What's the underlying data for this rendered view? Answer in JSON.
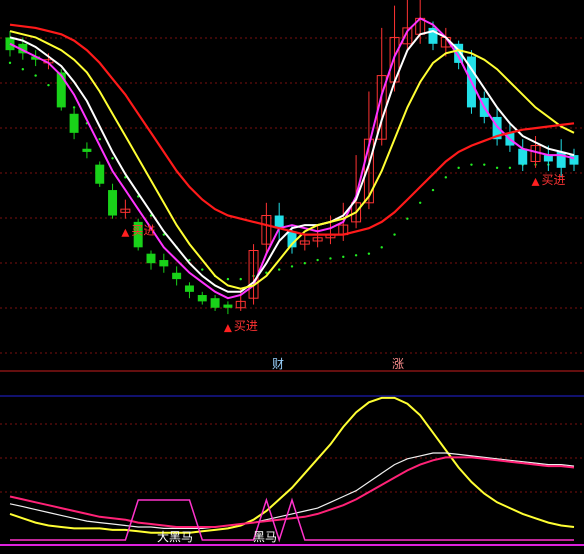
{
  "colors": {
    "background": "#000000",
    "up_candle": "#ff3333",
    "down_candle_light": "#22e0e8",
    "down_candle_dark": "#19d219",
    "ma_magenta": "#ff33ff",
    "ma_white": "#ffffff",
    "ma_yellow": "#ffff33",
    "ma_red": "#ff1a1a",
    "support_dots": "#22ee22",
    "grid": "#7a1010",
    "divider_red": "#c81e1e",
    "divider_blue": "#2222dd",
    "bottom_line": "#dd22dd",
    "osc_yellow": "#ffff33",
    "osc_white": "#f0f0f0",
    "osc_pink": "#ff2277",
    "osc_magenta": "#ff33cc"
  },
  "labels": {
    "buy1": "买进",
    "buy2": "买进",
    "buy3": "买进",
    "cai": "财",
    "zhang": "涨",
    "big_horse": "大黑马",
    "horse": "黑马"
  },
  "chart_data": [
    {
      "type": "candlestick",
      "title": "",
      "y_range": [
        0,
        100
      ],
      "grid": true,
      "candles": [
        {
          "o": 92,
          "c": 88,
          "h": 94,
          "l": 86
        },
        {
          "o": 90,
          "c": 87,
          "h": 92,
          "l": 85
        },
        {
          "o": 86,
          "c": 85,
          "h": 88,
          "l": 83
        },
        {
          "o": 84,
          "c": 85,
          "h": 87,
          "l": 82
        },
        {
          "o": 81,
          "c": 70,
          "h": 82,
          "l": 69
        },
        {
          "o": 68,
          "c": 62,
          "h": 70,
          "l": 60
        },
        {
          "o": 57,
          "c": 56,
          "h": 59,
          "l": 54
        },
        {
          "o": 52,
          "c": 46,
          "h": 53,
          "l": 45
        },
        {
          "o": 44,
          "c": 36,
          "h": 46,
          "l": 35
        },
        {
          "o": 37,
          "c": 38,
          "h": 41,
          "l": 35
        },
        {
          "o": 34,
          "c": 26,
          "h": 35,
          "l": 25
        },
        {
          "o": 24,
          "c": 21,
          "h": 25,
          "l": 19
        },
        {
          "o": 22,
          "c": 20,
          "h": 24,
          "l": 18
        },
        {
          "o": 18,
          "c": 16,
          "h": 20,
          "l": 14
        },
        {
          "o": 14,
          "c": 12,
          "h": 15,
          "l": 10
        },
        {
          "o": 11,
          "c": 9,
          "h": 12,
          "l": 8
        },
        {
          "o": 10,
          "c": 7,
          "h": 11,
          "l": 6
        },
        {
          "o": 8,
          "c": 7,
          "h": 9,
          "l": 5
        },
        {
          "o": 7,
          "c": 9,
          "h": 13,
          "l": 6
        },
        {
          "o": 10,
          "c": 25,
          "h": 27,
          "l": 8
        },
        {
          "o": 27,
          "c": 36,
          "h": 40,
          "l": 24
        },
        {
          "o": 36,
          "c": 32,
          "h": 40,
          "l": 28
        },
        {
          "o": 31,
          "c": 26,
          "h": 33,
          "l": 24
        },
        {
          "o": 27,
          "c": 28,
          "h": 30,
          "l": 25
        },
        {
          "o": 28,
          "c": 29,
          "h": 33,
          "l": 26
        },
        {
          "o": 29,
          "c": 30,
          "h": 36,
          "l": 27
        },
        {
          "o": 30,
          "c": 33,
          "h": 40,
          "l": 28
        },
        {
          "o": 34,
          "c": 40,
          "h": 55,
          "l": 32
        },
        {
          "o": 40,
          "c": 60,
          "h": 75,
          "l": 38
        },
        {
          "o": 60,
          "c": 80,
          "h": 95,
          "l": 58
        },
        {
          "o": 78,
          "c": 92,
          "h": 102,
          "l": 75
        },
        {
          "o": 90,
          "c": 95,
          "h": 105,
          "l": 88
        },
        {
          "o": 93,
          "c": 98,
          "h": 104,
          "l": 90
        },
        {
          "o": 95,
          "c": 90,
          "h": 97,
          "l": 88
        },
        {
          "o": 89,
          "c": 92,
          "h": 95,
          "l": 86
        },
        {
          "o": 90,
          "c": 84,
          "h": 91,
          "l": 82
        },
        {
          "o": 86,
          "c": 70,
          "h": 88,
          "l": 68
        },
        {
          "o": 73,
          "c": 67,
          "h": 75,
          "l": 65
        },
        {
          "o": 67,
          "c": 60,
          "h": 70,
          "l": 58
        },
        {
          "o": 62,
          "c": 58,
          "h": 65,
          "l": 56
        },
        {
          "o": 57,
          "c": 52,
          "h": 60,
          "l": 50
        },
        {
          "o": 53,
          "c": 58,
          "h": 61,
          "l": 51
        },
        {
          "o": 55,
          "c": 53,
          "h": 58,
          "l": 50
        },
        {
          "o": 56,
          "c": 51,
          "h": 60,
          "l": 48
        },
        {
          "o": 55,
          "c": 52,
          "h": 57,
          "l": 50
        }
      ],
      "series": [
        {
          "color": "ma_magenta",
          "values": [
            90,
            88,
            86,
            84,
            80,
            74,
            66,
            58,
            50,
            44,
            38,
            32,
            26,
            22,
            18,
            15,
            12,
            10,
            11,
            14,
            24,
            32,
            33,
            32,
            31,
            32,
            34,
            42,
            58,
            74,
            86,
            94,
            98,
            96,
            92,
            86,
            78,
            70,
            64,
            60,
            57,
            56,
            55,
            55,
            54
          ]
        },
        {
          "color": "ma_white",
          "values": [
            92,
            91,
            89,
            86,
            83,
            78,
            72,
            64,
            56,
            49,
            43,
            37,
            31,
            26,
            21,
            17,
            14,
            12,
            12,
            15,
            21,
            28,
            32,
            33,
            33,
            34,
            36,
            41,
            52,
            66,
            78,
            88,
            93,
            94,
            92,
            88,
            82,
            76,
            70,
            65,
            61,
            59,
            57,
            56,
            55
          ]
        },
        {
          "color": "ma_yellow",
          "values": [
            94,
            93,
            92,
            90,
            88,
            85,
            81,
            75,
            68,
            61,
            54,
            47,
            40,
            33,
            27,
            22,
            17,
            14,
            13,
            14,
            17,
            22,
            27,
            31,
            33,
            34,
            35,
            37,
            42,
            50,
            60,
            70,
            78,
            84,
            87,
            88,
            87,
            85,
            82,
            78,
            74,
            70,
            67,
            64,
            62
          ]
        },
        {
          "color": "ma_red",
          "values": [
            96,
            95.5,
            95,
            94,
            93,
            91,
            88,
            84,
            79,
            74,
            68,
            62,
            56,
            50,
            45,
            41,
            38,
            36,
            35,
            34,
            33,
            32,
            31,
            30,
            30,
            30,
            30,
            31,
            32,
            34,
            37,
            41,
            45,
            49,
            53,
            56,
            58,
            59.5,
            61,
            62,
            63,
            63.5,
            64,
            64.5,
            65
          ]
        },
        {
          "color": "support_dots",
          "values": [
            84,
            82,
            80,
            77,
            74,
            70,
            65,
            60,
            54,
            48,
            42,
            36,
            30,
            26,
            22,
            19,
            17,
            16,
            16,
            17,
            18,
            19,
            20,
            21,
            22,
            22.5,
            23,
            23.5,
            24,
            26,
            30,
            35,
            40,
            44,
            48,
            51,
            52,
            52,
            51,
            51,
            52,
            52,
            52,
            53,
            53
          ]
        }
      ],
      "markers": [
        {
          "index": 9,
          "kind": "buy",
          "label_key": "buy1"
        },
        {
          "index": 17,
          "kind": "buy",
          "label_key": "buy2"
        },
        {
          "index": 41,
          "kind": "buy",
          "label_key": "buy3"
        }
      ]
    },
    {
      "type": "line",
      "title": "",
      "y_range": [
        0,
        100
      ],
      "series": [
        {
          "color": "osc_yellow",
          "values": [
            18,
            15,
            12,
            10,
            9,
            8,
            8,
            8,
            7,
            7,
            6,
            5,
            5,
            5,
            5,
            6,
            7,
            8,
            10,
            14,
            20,
            28,
            36,
            46,
            56,
            66,
            78,
            88,
            95,
            98,
            98,
            94,
            86,
            74,
            62,
            50,
            40,
            32,
            26,
            22,
            18,
            15,
            12,
            10,
            9
          ]
        },
        {
          "color": "osc_white",
          "values": [
            25,
            23,
            21,
            19,
            17,
            15,
            13,
            12,
            11,
            10,
            9,
            9,
            8,
            8,
            8,
            8,
            9,
            10,
            11,
            12,
            14,
            16,
            18,
            20,
            22,
            26,
            30,
            34,
            40,
            46,
            52,
            56,
            58,
            60,
            60,
            59,
            58,
            57,
            56,
            55,
            54,
            53,
            52,
            52,
            51
          ]
        },
        {
          "color": "osc_pink",
          "values": [
            30,
            28,
            26,
            24,
            22,
            20,
            18,
            16,
            15,
            14,
            12,
            11,
            10,
            9,
            9,
            9,
            9,
            10,
            11,
            12,
            13,
            14,
            15,
            16,
            18,
            21,
            24,
            28,
            33,
            38,
            43,
            48,
            52,
            55,
            57,
            57,
            57,
            56,
            55,
            54,
            53,
            52,
            51,
            51,
            50
          ]
        }
      ],
      "signal_wave": [
        0,
        0,
        0,
        0,
        0,
        0,
        0,
        0,
        0,
        0,
        1,
        1,
        1,
        1,
        1,
        0,
        0,
        0,
        0,
        0,
        1,
        0,
        1,
        0,
        0,
        0,
        0,
        0,
        0,
        0,
        0,
        0,
        0,
        0,
        0,
        0,
        0,
        0,
        0,
        0,
        0,
        0,
        0,
        0,
        0
      ]
    }
  ]
}
